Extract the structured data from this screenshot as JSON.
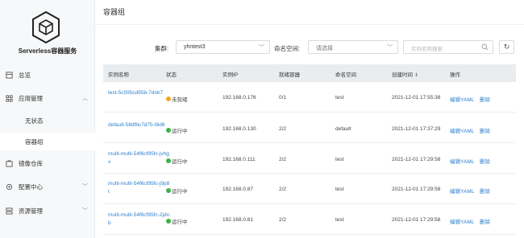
{
  "sidebar": {
    "product_name": "Serverless容器服务",
    "items": [
      {
        "label": "总览",
        "icon": "overview-icon",
        "has_chevron": false
      },
      {
        "label": "应用管理",
        "icon": "app-manage-icon",
        "has_chevron": true,
        "chevron": "up"
      },
      {
        "label": "无状态",
        "sub": true
      },
      {
        "label": "容器组",
        "sub": true,
        "active": true
      },
      {
        "label": "镜像仓库",
        "icon": "image-repo-icon",
        "has_chevron": false
      },
      {
        "label": "配置中心",
        "icon": "config-center-icon",
        "has_chevron": true,
        "chevron": "down"
      },
      {
        "label": "资源管理",
        "icon": "resource-manage-icon",
        "has_chevron": true,
        "chevron": "down"
      }
    ]
  },
  "header": {
    "title": "容器组"
  },
  "filters": {
    "cluster_label": "集群:",
    "cluster_value": "yhntest3",
    "namespace_label": "命名空间:",
    "namespace_placeholder": "请选择",
    "search_placeholder": "实例名称搜索"
  },
  "table": {
    "columns": [
      "实例名称",
      "状态",
      "实例IP",
      "就绪容器",
      "命名空间",
      "创建时间",
      "操作"
    ],
    "sort_column": "创建时间",
    "rows": [
      {
        "name": "test-5c595cd95b-7dnk7",
        "status": "未就绪",
        "status_type": "warn",
        "ip": "192.168.0.176",
        "ready": "0/1",
        "namespace": "test",
        "created": "2021-12-01 17:55:38",
        "edit": "编辑YAML",
        "delete": "删除"
      },
      {
        "name": "default-58dfbc7d75-t8d6",
        "status": "运行中",
        "status_type": "ok",
        "ip": "192.168.0.130",
        "ready": "2/2",
        "namespace": "default",
        "created": "2021-12-01 17:37:29",
        "edit": "编辑YAML",
        "delete": "删除"
      },
      {
        "name": "multi-multi-54f6cf95fc-jvhgv",
        "status": "运行中",
        "status_type": "ok",
        "ip": "192.168.0.111",
        "ready": "2/2",
        "namespace": "test",
        "created": "2021-12-01 17:29:58",
        "edit": "编辑YAML",
        "delete": "删除"
      },
      {
        "name": "multi-multi-54f6cf95fc-j9p8t",
        "status": "运行中",
        "status_type": "ok",
        "ip": "192.168.0.87",
        "ready": "2/2",
        "namespace": "test",
        "created": "2021-12-01 17:29:58",
        "edit": "编辑YAML",
        "delete": "删除"
      },
      {
        "name": "multi-multi-54f6cf95fc-2jdnb",
        "status": "运行中",
        "status_type": "ok",
        "ip": "192.168.0.81",
        "ready": "2/2",
        "namespace": "test",
        "created": "2021-12-01 17:29:58",
        "edit": "编辑YAML",
        "delete": "删除"
      }
    ]
  },
  "colors": {
    "link": "#2f80d1",
    "ok": "#3bb345",
    "warn": "#f1a525",
    "header_bg": "#eaedf0"
  }
}
